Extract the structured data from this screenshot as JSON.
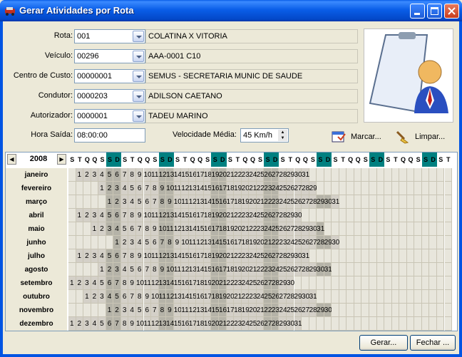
{
  "window": {
    "title": "Gerar Atividades por Rota"
  },
  "form": {
    "rota": {
      "label": "Rota:",
      "code": "001",
      "desc": "COLATINA X VITORIA"
    },
    "veiculo": {
      "label": "Veículo:",
      "code": "00296",
      "desc": "AAA-0001  C10"
    },
    "centro": {
      "label": "Centro de Custo:",
      "code": "00000001",
      "desc": "SEMUS - SECRETARIA MUNIC DE SAUDE"
    },
    "condutor": {
      "label": "Condutor:",
      "code": "0000203",
      "desc": "ADILSON CAETANO"
    },
    "autorizador": {
      "label": "Autorizador:",
      "code": "0000001",
      "desc": "TADEU MARINO"
    },
    "hora": {
      "label": "Hora Saída:",
      "value": "08:00:00"
    },
    "velocidade": {
      "label": "Velocidade Média:",
      "value": "45 Km/h"
    },
    "marcar_label": "Marcar...",
    "limpar_label": "Limpar..."
  },
  "calendar": {
    "year": "2008",
    "weekday_header": [
      "S",
      "T",
      "Q",
      "Q",
      "S",
      "S",
      "D",
      "S",
      "T",
      "Q",
      "Q",
      "S",
      "S",
      "D",
      "S",
      "T",
      "Q",
      "Q",
      "S",
      "S",
      "D",
      "S",
      "T",
      "Q",
      "Q",
      "S",
      "S",
      "D",
      "S",
      "T",
      "Q",
      "Q",
      "S",
      "S",
      "D",
      "S",
      "T",
      "Q",
      "Q",
      "S",
      "S",
      "D",
      "S",
      "T",
      "Q",
      "Q",
      "S",
      "S",
      "D",
      "S",
      "T"
    ],
    "months": [
      {
        "name": "janeiro",
        "offset": 1,
        "days": 31
      },
      {
        "name": "fevereiro",
        "offset": 4,
        "days": 29
      },
      {
        "name": "março",
        "offset": 5,
        "days": 31
      },
      {
        "name": "abril",
        "offset": 1,
        "days": 30
      },
      {
        "name": "maio",
        "offset": 3,
        "days": 31
      },
      {
        "name": "junho",
        "offset": 6,
        "days": 30
      },
      {
        "name": "julho",
        "offset": 1,
        "days": 31
      },
      {
        "name": "agosto",
        "offset": 4,
        "days": 31
      },
      {
        "name": "setembro",
        "offset": 0,
        "days": 30
      },
      {
        "name": "outubro",
        "offset": 2,
        "days": 31
      },
      {
        "name": "novembro",
        "offset": 5,
        "days": 30
      },
      {
        "name": "dezembro",
        "offset": 0,
        "days": 31
      }
    ]
  },
  "buttons": {
    "gerar": "Gerar...",
    "fechar": "Fechar ..."
  }
}
